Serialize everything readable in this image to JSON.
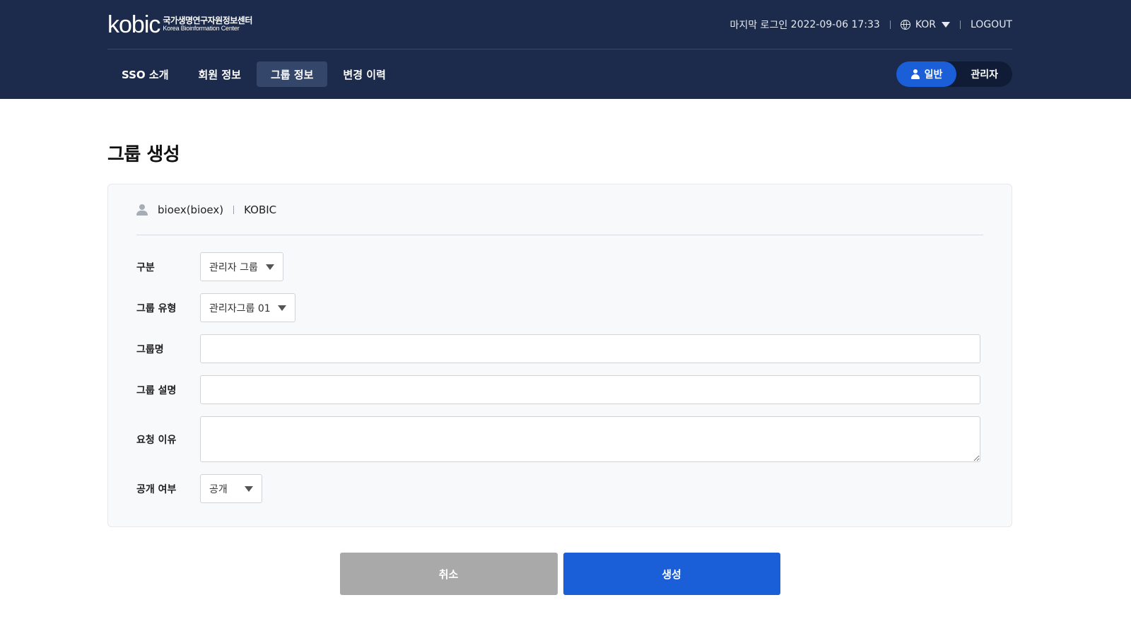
{
  "logo": {
    "mark": "kobic",
    "name_ko": "국가생명연구자원정보센터",
    "name_en": "Korea Bioinformation Center"
  },
  "top_bar": {
    "last_login_label": "마지막 로그인",
    "last_login_time": "2022-09-06 17:33",
    "language": "KOR",
    "logout_label": "LOGOUT"
  },
  "nav": {
    "items": [
      {
        "label": "SSO 소개"
      },
      {
        "label": "회원 정보"
      },
      {
        "label": "그룹 정보"
      },
      {
        "label": "변경 이력"
      }
    ],
    "active_index": 2
  },
  "role_toggle": {
    "general_label": "일반",
    "admin_label": "관리자",
    "active": "general"
  },
  "page": {
    "title": "그룹 생성"
  },
  "user": {
    "id_display": "bioex(bioex)",
    "org": "KOBIC"
  },
  "form": {
    "category_label": "구분",
    "category_value": "관리자 그룹",
    "group_type_label": "그룹 유형",
    "group_type_value": "관리자그룹 01",
    "group_name_label": "그룹명",
    "group_name_value": "",
    "group_desc_label": "그룹 설명",
    "group_desc_value": "",
    "request_reason_label": "요청 이유",
    "request_reason_value": "",
    "visibility_label": "공개 여부",
    "visibility_value": "공개"
  },
  "actions": {
    "cancel_label": "취소",
    "create_label": "생성"
  },
  "colors": {
    "header_bg": "#1c2b4b",
    "accent_blue": "#1a5ed8",
    "cancel_gray": "#a9a9a9"
  }
}
